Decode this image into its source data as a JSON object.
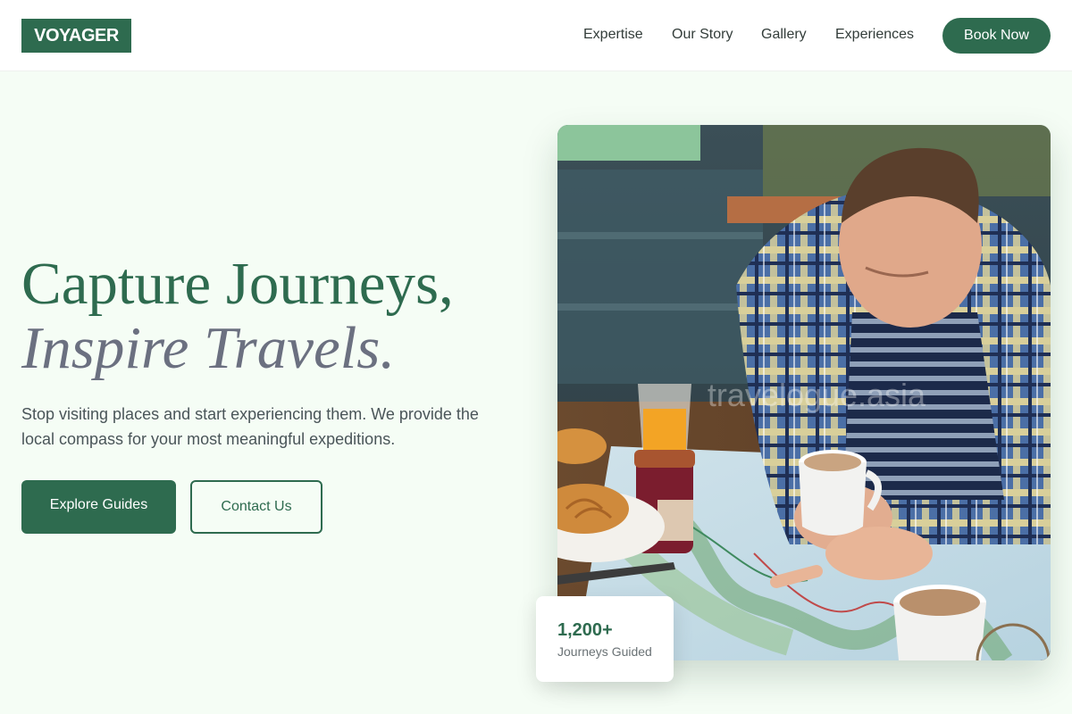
{
  "header": {
    "logo": "VOYAGER",
    "nav": [
      "Expertise",
      "Our Story",
      "Gallery",
      "Experiences"
    ],
    "cta": "Book Now"
  },
  "hero": {
    "title_line1": "Capture Journeys,",
    "title_line2": "Inspire Travels.",
    "description": "Stop visiting places and start experiencing them. We provide the local compass for your most meaningful expeditions.",
    "primary_button": "Explore Guides",
    "secondary_button": "Contact Us"
  },
  "photo": {
    "watermark": "travelogue.asia"
  },
  "stat": {
    "value": "1,200+",
    "label": "Journeys Guided"
  },
  "colors": {
    "brand": "#2e6b4f",
    "accent_text": "#6b7080",
    "background": "#f5fdf5"
  }
}
